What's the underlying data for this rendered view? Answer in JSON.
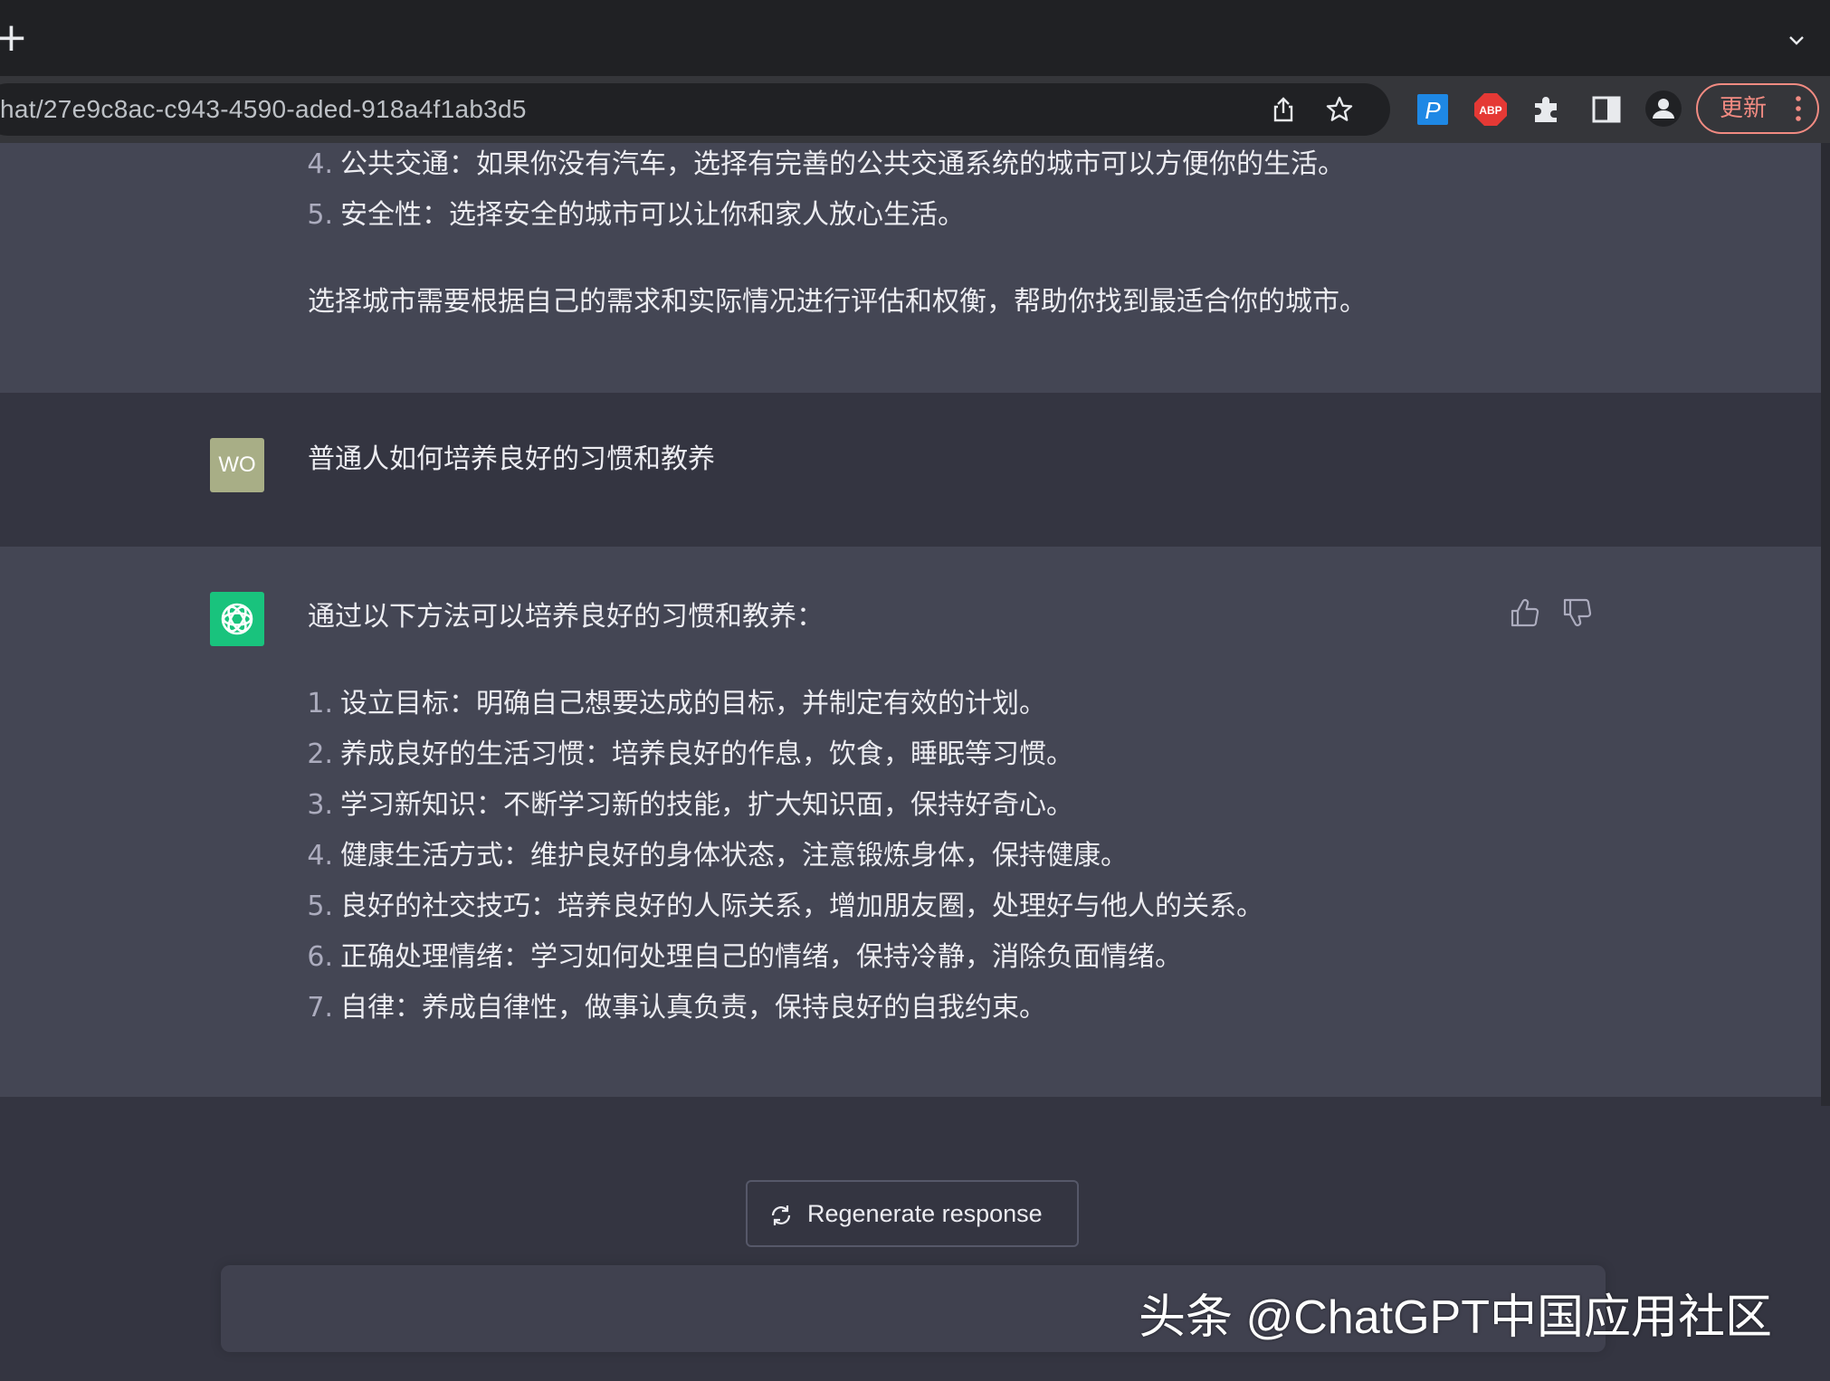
{
  "browser": {
    "new_tab_label": "+",
    "url": "hat/27e9c8ac-c943-4590-aded-918a4f1ab3d5",
    "update_label": "更新",
    "extensions": [
      "share-icon",
      "bookmark-star-icon",
      "p-extension-icon",
      "adblock-icon",
      "puzzle-icon",
      "sidepanel-icon",
      "profile-icon"
    ],
    "abp_text": "ABP",
    "p_text": "P"
  },
  "prev_answer": {
    "items": [
      {
        "num": "4.",
        "text": "公共交通：如果你没有汽车，选择有完善的公共交通系统的城市可以方便你的生活。"
      },
      {
        "num": "5.",
        "text": "安全性：选择安全的城市可以让你和家人放心生活。"
      }
    ],
    "conclusion": "选择城市需要根据自己的需求和实际情况进行评估和权衡，帮助你找到最适合你的城市。"
  },
  "user_message": {
    "avatar_initials": "WO",
    "text": "普通人如何培养良好的习惯和教养"
  },
  "assistant_message": {
    "intro": "通过以下方法可以培养良好的习惯和教养：",
    "items": [
      {
        "num": "1.",
        "text": "设立目标：明确自己想要达成的目标，并制定有效的计划。"
      },
      {
        "num": "2.",
        "text": "养成良好的生活习惯：培养良好的作息，饮食，睡眠等习惯。"
      },
      {
        "num": "3.",
        "text": "学习新知识：不断学习新的技能，扩大知识面，保持好奇心。"
      },
      {
        "num": "4.",
        "text": "健康生活方式：维护良好的身体状态，注意锻炼身体，保持健康。"
      },
      {
        "num": "5.",
        "text": "良好的社交技巧：培养良好的人际关系，增加朋友圈，处理好与他人的关系。"
      },
      {
        "num": "6.",
        "text": "正确处理情绪：学习如何处理自己的情绪，保持冷静，消除负面情绪。"
      },
      {
        "num": "7.",
        "text": "自律：养成自律性，做事认真负责，保持良好的自我约束。"
      }
    ]
  },
  "controls": {
    "regenerate_label": "Regenerate response",
    "input_value": ""
  },
  "watermark": "头条 @ChatGPT中国应用社区",
  "colors": {
    "page_bg": "#343541",
    "assistant_bg": "#444654",
    "gpt_green": "#19c37d",
    "user_avatar": "#a8ae86",
    "update_accent": "#f28b82"
  }
}
